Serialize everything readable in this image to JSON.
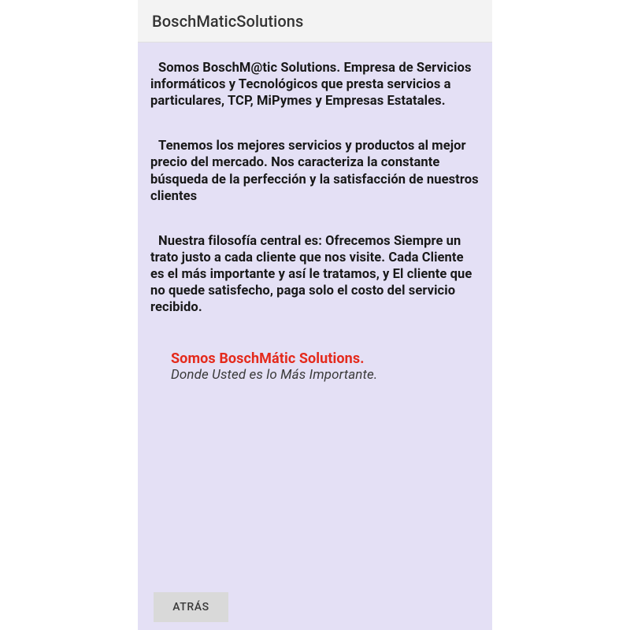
{
  "header": {
    "title": "BoschMaticSolutions"
  },
  "content": {
    "para1": "Somos BoschM@tic Solutions. Empresa de Servicios informáticos y Tecnológicos que presta servicios a particulares, TCP, MiPymes y Empresas Estatales.",
    "para2": "Tenemos los mejores servicios y productos al mejor precio del mercado. Nos caracteriza la constante búsqueda de la perfección y la satisfacción de nuestros clientes",
    "para3": "Nuestra filosofía central es: Ofrecemos Siempre un trato justo a cada cliente que nos visite. Cada Cliente es el más importante y así le tratamos, y El cliente que no quede satisfecho, paga solo el costo del servicio recibido."
  },
  "slogan": {
    "title": "Somos BoschMátic Solutions.",
    "subtitle": "Donde Usted es lo Más Importante."
  },
  "buttons": {
    "back": "ATRÁS"
  },
  "colors": {
    "accent_red": "#e42a1c",
    "content_bg": "#e4e0f5",
    "title_bar_bg": "#f3f3f3",
    "button_bg": "#d9d9d9"
  }
}
